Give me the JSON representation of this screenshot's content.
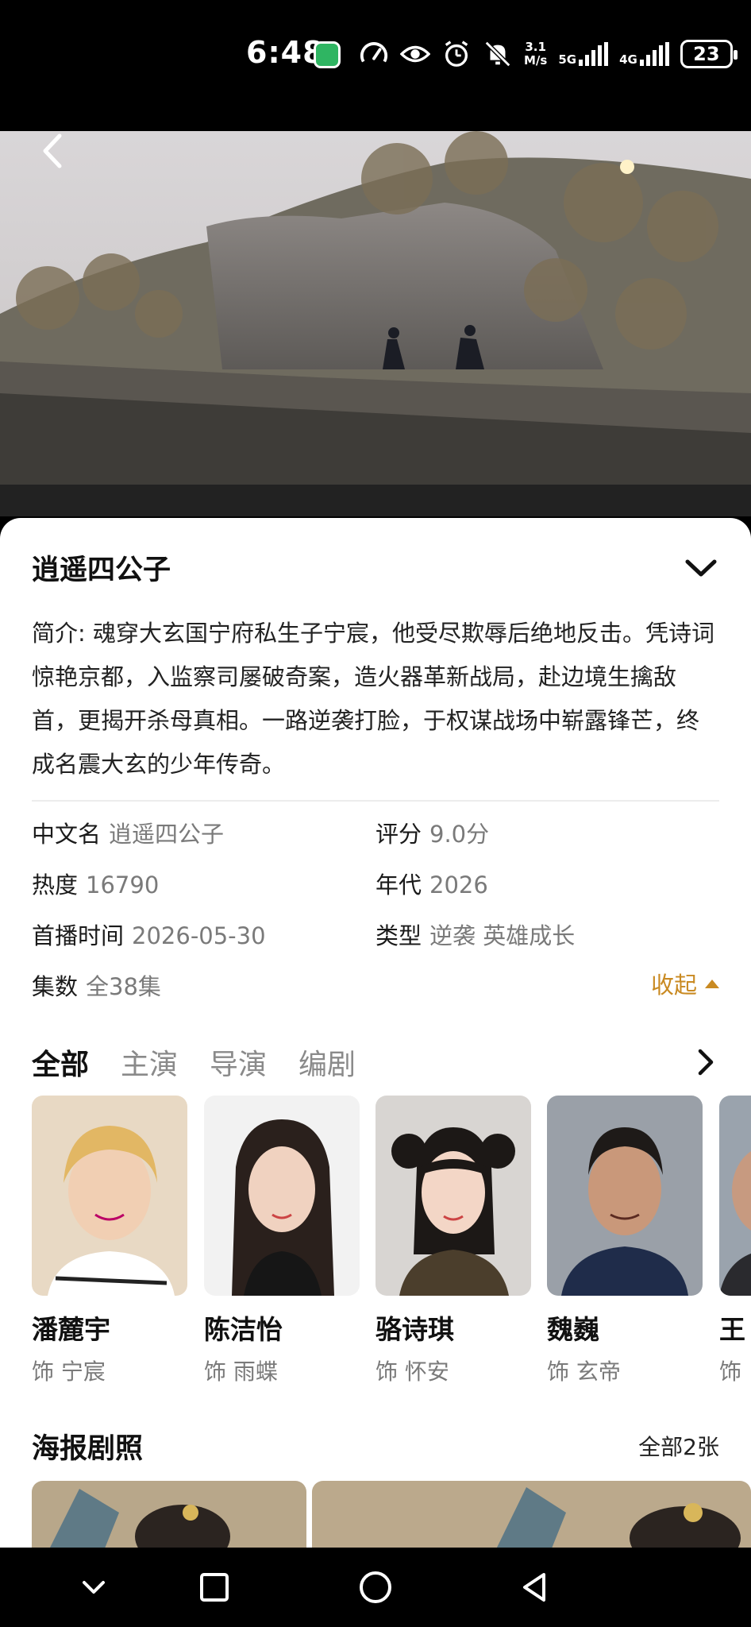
{
  "status_bar": {
    "time": "6:48",
    "net_speed_value": "3.1",
    "net_speed_unit": "M/s",
    "net1": "5G",
    "net2": "4G",
    "battery": "23",
    "icons": [
      "app-badge-icon",
      "speedometer-icon",
      "eye-icon",
      "alarm-icon",
      "mute-bell-icon",
      "signal-icon",
      "battery-icon"
    ]
  },
  "hero": {
    "description_icon": "back-arrow-icon"
  },
  "show": {
    "title": "逍遥四公子",
    "synopsis": "简介: 魂穿大玄国宁府私生子宁宸，他受尽欺辱后绝地反击。凭诗词惊艳京都，入监察司屡破奇案，造火器革新战局，赴边境生擒敌首，更揭开杀母真相。一路逆袭打脸，于权谋战场中崭露锋芒，终成名震大玄的少年传奇。"
  },
  "info": {
    "chinese_name_key": "中文名",
    "chinese_name": "逍遥四公子",
    "rating_key": "评分",
    "rating": "9.0分",
    "heat_key": "热度",
    "heat": "16790",
    "era_key": "年代",
    "era": "2026",
    "premiere_key": "首播时间",
    "premiere": "2026-05-30",
    "genre_key": "类型",
    "genre": "逆袭 英雄成长",
    "episodes_key": "集数",
    "episodes": "全38集",
    "fold_label": "收起"
  },
  "tabs": [
    {
      "label": "全部",
      "active": true
    },
    {
      "label": "主演",
      "active": false
    },
    {
      "label": "导演",
      "active": false
    },
    {
      "label": "编剧",
      "active": false
    }
  ],
  "cast": [
    {
      "name": "潘麓宇",
      "role": "饰 宁宸"
    },
    {
      "name": "陈洁怡",
      "role": "饰 雨蝶"
    },
    {
      "name": "骆诗琪",
      "role": "饰 怀安"
    },
    {
      "name": "魏巍",
      "role": "饰 玄帝"
    },
    {
      "name": "王",
      "role": "饰"
    }
  ],
  "posters": {
    "title": "海报剧照",
    "all_label": "全部2张"
  },
  "colors": {
    "accent": "#c98a22",
    "text_primary": "#111111",
    "text_secondary": "#7a7a7a"
  }
}
